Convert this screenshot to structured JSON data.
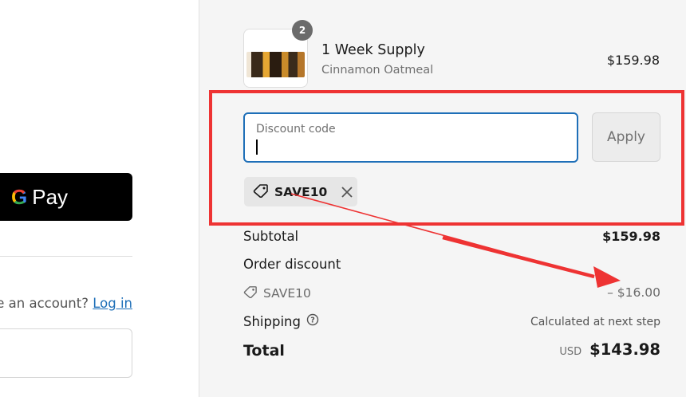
{
  "left": {
    "gpay": {
      "g": "G",
      "pay": "Pay"
    },
    "account_prompt": "e an account?",
    "login_link": "Log in"
  },
  "cart": {
    "item": {
      "quantity": "2",
      "name": "1 Week Supply",
      "variant": "Cinnamon Oatmeal",
      "price": "$159.98"
    },
    "discount_field": {
      "label": "Discount code",
      "value": "",
      "apply_label": "Apply"
    },
    "applied_code": "SAVE10",
    "summary": {
      "subtotal_label": "Subtotal",
      "subtotal_value": "$159.98",
      "order_discount_label": "Order discount",
      "discount_code": "SAVE10",
      "discount_amount": "– $16.00",
      "shipping_label": "Shipping",
      "shipping_note": "Calculated at next step",
      "total_label": "Total",
      "currency": "USD",
      "total_value": "$143.98"
    }
  },
  "annotation": {
    "color": "#ee3333"
  },
  "colors": {
    "accent": "#1e6fb8",
    "summary_bg": "#f5f5f5",
    "gpay_bg": "#000000"
  }
}
